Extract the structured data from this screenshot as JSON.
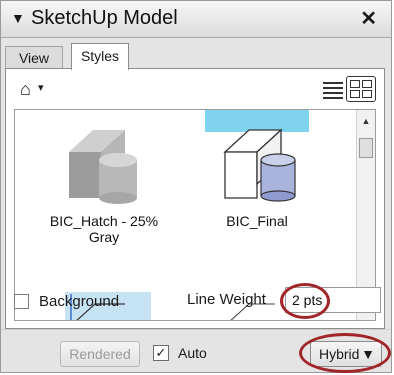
{
  "window": {
    "title": "SketchUp Model",
    "collapse_glyph": "▼",
    "close_glyph": "✕"
  },
  "tabs": [
    {
      "label": "View"
    },
    {
      "label": "Styles",
      "active": true
    }
  ],
  "toolbar": {
    "home_glyph": "⌂",
    "dropdown_glyph": "▾"
  },
  "styles": [
    {
      "name": "BIC_Hatch - 25%",
      "name_line2": "Gray"
    },
    {
      "name": "BIC_Final"
    }
  ],
  "scrollbar": {
    "up_glyph": "▲",
    "down_glyph": "▼"
  },
  "options": {
    "background_label": "Background",
    "background_checked": false,
    "line_weight_label": "Line Weight",
    "line_weight_value": "2 pts"
  },
  "bottom": {
    "rendered_label": "Rendered",
    "auto_label": "Auto",
    "auto_checked": true,
    "check_glyph": "✓",
    "mode_value": "Hybrid",
    "mode_arrow": "▼"
  },
  "colors": {
    "annotation_ring": "#a0262a",
    "sky": "#7fd3ee",
    "cylinder": "#a9b4dc"
  }
}
